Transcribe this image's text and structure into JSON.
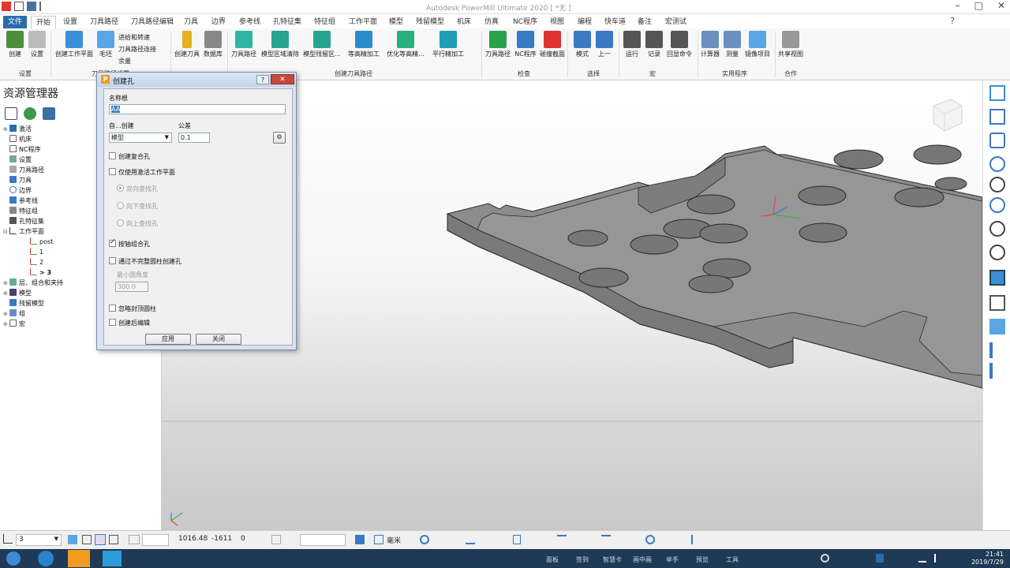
{
  "app": {
    "window_title": "Autodesk PowerMill Ultimate 2020   [ *无 ]"
  },
  "tabs": [
    "文件",
    "开始",
    "设置",
    "刀具路径",
    "刀具路径编辑",
    "刀具",
    "边界",
    "参考线",
    "孔特征集",
    "特征组",
    "工作平面",
    "模型",
    "残留模型",
    "机床",
    "仿真",
    "NC程序",
    "视图",
    "编程",
    "快车道",
    "备注",
    "宏测试"
  ],
  "ribbon": {
    "buttons": [
      "创建",
      "设置",
      "创建工作平面",
      "毛坯",
      "创建刀具",
      "数据库",
      "刀具路径",
      "模型区域清除",
      "模型残留区...",
      "等高精加工",
      "优化等高精...",
      "平行精加工",
      "刀具路径",
      "NC程序",
      "碰撞截面",
      "模式",
      "上一",
      "运行",
      "记录",
      "回显命令",
      "计算器",
      "测量",
      "镜像项目",
      "共享视图"
    ],
    "small": [
      "进给和转速",
      "刀具路径连接",
      "余量"
    ],
    "groups": [
      "设置",
      "刀具路径设置",
      "创建刀具路径",
      "检查",
      "选择",
      "宏",
      "实用程序",
      "合作"
    ]
  },
  "explorer": {
    "title": "资源管理器",
    "items": [
      "激活",
      "机床",
      "NC程序",
      "设置",
      "刀具路径",
      "刀具",
      "边界",
      "参考线",
      "特征组",
      "孔特征集",
      "工作平面",
      "post",
      "1",
      "2",
      "> 3",
      "层、组合和夹持",
      "模型",
      "残留模型",
      "组",
      "宏"
    ]
  },
  "dialog": {
    "title": "创建孔",
    "name_label": "名称根",
    "name_value": "AA",
    "from_label": "自...创建",
    "from_value": "模型",
    "tol_label": "公差",
    "tol_value": "0.1",
    "compound": "创建复合孔",
    "active_wp": "仅使用激活工作平面",
    "radio_any": "双向查找孔",
    "radio_down": "向下查找孔",
    "radio_up": "向上查找孔",
    "axis_group": "按轴组合孔",
    "incomplete": "通过不完整圆柱创建孔",
    "min_angle_label": "最小圆角度",
    "min_angle_value": "300.0",
    "ignore_capped": "忽略封顶圆柱",
    "edit_after": "创建后编辑",
    "apply": "应用",
    "close": "关闭"
  },
  "status": {
    "workplane": "3",
    "x": "1016.48",
    "y": "-1611",
    "z": "0",
    "unit": "毫米"
  },
  "taskbar": {
    "items": [
      "面板",
      "签到",
      "智慧卡",
      "画中画",
      "举手",
      "预览",
      "工具"
    ],
    "time": "21:41",
    "date": "2019/7/29"
  },
  "colors": {
    "accent": "#2b6cb0",
    "model": "#8e8e8e",
    "dialog_title": "#c3d5eb"
  }
}
